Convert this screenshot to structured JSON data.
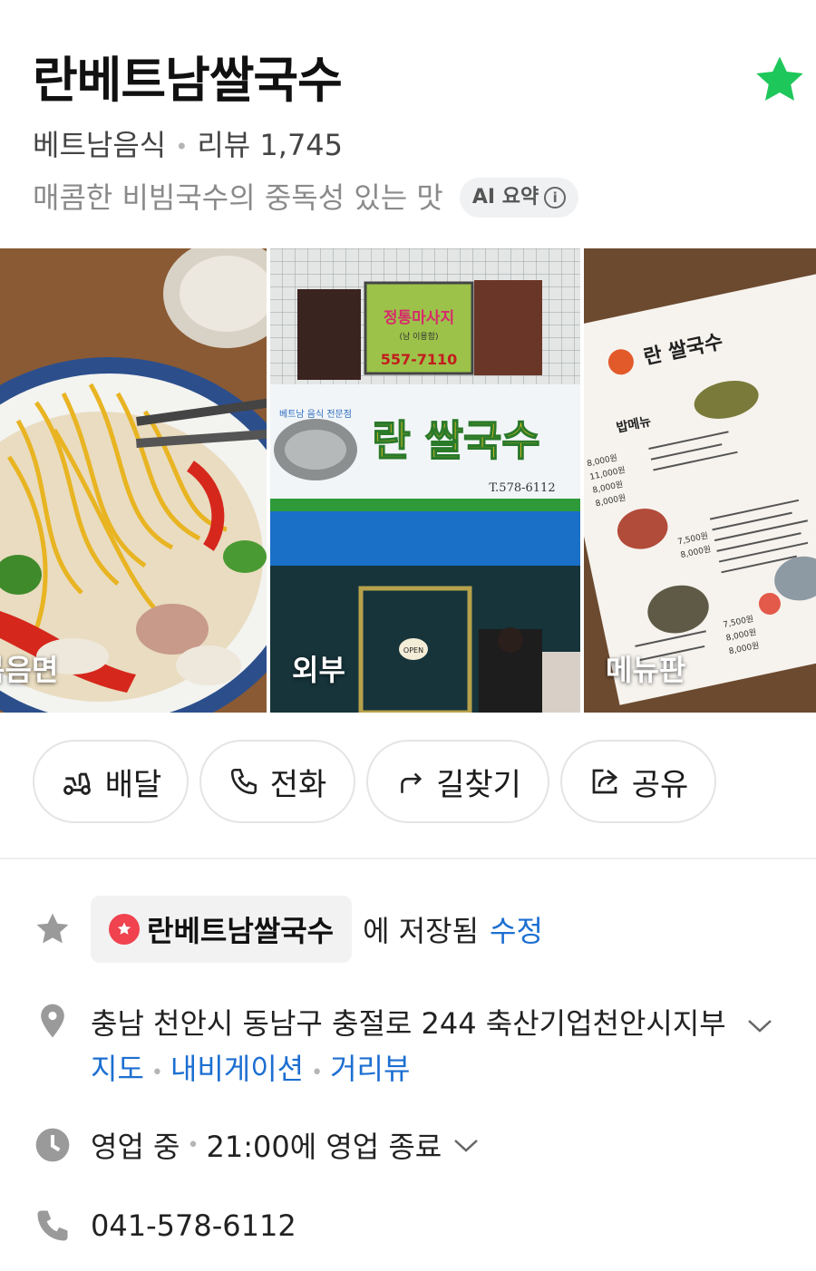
{
  "place": {
    "name": "란베트남쌀국수",
    "category": "베트남음식",
    "review_label": "리뷰 1,745",
    "summary": "매콤한 비빔국수의 중독성 있는 맛",
    "ai_summary_label": "AI 요약"
  },
  "photos": [
    {
      "caption": "볶음면"
    },
    {
      "caption": "외부"
    },
    {
      "caption": "메뉴판"
    }
  ],
  "storefront": {
    "sign_main": "란 쌀국수",
    "sign_sub": "베트남 음식 전문점",
    "sign_phone": "T.578-6112",
    "upper_sign": "정통마사지",
    "upper_sign_sub": "(남 이용함)",
    "upper_phone": "557-7110",
    "door_sign": "OPEN"
  },
  "menu_board": {
    "title": "란 쌀국수",
    "section": "밥메뉴",
    "prices": [
      "8,000원",
      "11,000원",
      "8,000원",
      "8,000원",
      "7,500원",
      "8,000원",
      "7,500원",
      "8,000원",
      "8,000원"
    ]
  },
  "actions": [
    {
      "label": "배달",
      "icon": "delivery-scooter-icon"
    },
    {
      "label": "전화",
      "icon": "phone-icon"
    },
    {
      "label": "길찾기",
      "icon": "directions-icon"
    },
    {
      "label": "공유",
      "icon": "share-icon"
    }
  ],
  "saved": {
    "list_name": "란베트남쌀국수",
    "suffix": "에 저장됨",
    "edit_label": "수정"
  },
  "address": {
    "text": "충남 천안시 동남구 충절로 244 축산기업천안시지부",
    "links": [
      "지도",
      "내비게이션",
      "거리뷰"
    ]
  },
  "hours": {
    "status": "영업 중",
    "detail": "21:00에 영업 종료"
  },
  "phone": {
    "number": "041-578-6112"
  },
  "colors": {
    "favorite_star": "#1ec75a",
    "link": "#1c6fd1",
    "saved_marker": "#f0424f",
    "icon_gray": "#9a9a9a"
  }
}
